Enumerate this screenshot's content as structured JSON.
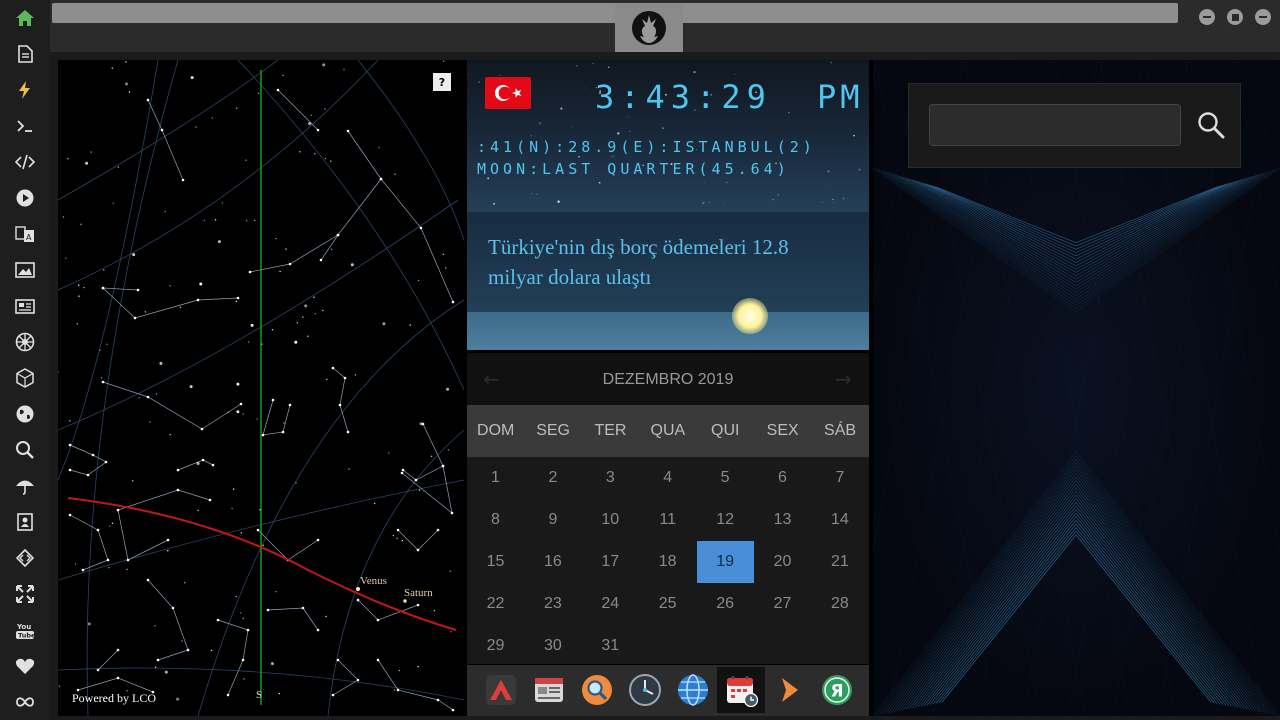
{
  "sidebar": {
    "items": [
      {
        "name": "home-icon",
        "color": "#5cb85c"
      },
      {
        "name": "document-icon",
        "color": "#e0e0e0"
      },
      {
        "name": "lightning-icon",
        "color": "#f0c040"
      },
      {
        "name": "terminal-icon",
        "color": "#e0e0e0"
      },
      {
        "name": "code-icon",
        "color": "#e0e0e0"
      },
      {
        "name": "play-icon",
        "color": "#e0e0e0"
      },
      {
        "name": "translate-icon",
        "color": "#e0e0e0"
      },
      {
        "name": "image-icon",
        "color": "#e0e0e0"
      },
      {
        "name": "newspaper-icon",
        "color": "#e0e0e0"
      },
      {
        "name": "empire-icon",
        "color": "#e0e0e0"
      },
      {
        "name": "cube-icon",
        "color": "#e0e0e0"
      },
      {
        "name": "globe-icon",
        "color": "#e0e0e0"
      },
      {
        "name": "search-icon",
        "color": "#e0e0e0"
      },
      {
        "name": "umbrella-icon",
        "color": "#e0e0e0"
      },
      {
        "name": "contact-book-icon",
        "color": "#e0e0e0"
      },
      {
        "name": "code-tag-icon",
        "color": "#e0e0e0"
      },
      {
        "name": "expand-icon",
        "color": "#e0e0e0"
      },
      {
        "name": "youtube-icon",
        "color": "#e0e0e0",
        "label": "You Tube"
      },
      {
        "name": "heart-icon",
        "color": "#e0e0e0"
      },
      {
        "name": "infinity-icon",
        "color": "#e0e0e0"
      }
    ]
  },
  "window": {
    "logo_icon": "rebel-alliance-icon"
  },
  "sky": {
    "help": "?",
    "powered": "Powered by LCO",
    "compass": "S",
    "planets": [
      {
        "name": "Venus"
      },
      {
        "name": "Saturn"
      }
    ]
  },
  "clock": {
    "time": "3:43:29",
    "ampm": "PM",
    "location": ":41(N):28.9(E):ISTANBUL(2)",
    "moon": "MOON:LAST QUARTER(45.64)",
    "flag": "turkey-flag",
    "news": "Türkiye'nin dış borç ödemeleri 12.8 milyar dolara ulaştı"
  },
  "calendar": {
    "month": "DEZEMBRO 2019",
    "prev": "←",
    "next": "→",
    "weekdays": [
      "DOM",
      "SEG",
      "TER",
      "QUA",
      "QUI",
      "SEX",
      "SÁB"
    ],
    "days": [
      "1",
      "2",
      "3",
      "4",
      "5",
      "6",
      "7",
      "8",
      "9",
      "10",
      "11",
      "12",
      "13",
      "14",
      "15",
      "16",
      "17",
      "18",
      "19",
      "20",
      "21",
      "22",
      "23",
      "24",
      "25",
      "26",
      "27",
      "28",
      "29",
      "30",
      "31"
    ],
    "first_weekday": 0,
    "today": "19",
    "today_color": "#4a8ed8"
  },
  "dock": {
    "items": [
      {
        "name": "app-launcher-icon"
      },
      {
        "name": "news-reader-icon"
      },
      {
        "name": "search-app-icon"
      },
      {
        "name": "clock-app-icon"
      },
      {
        "name": "browser-globe-icon"
      },
      {
        "name": "calendar-app-icon",
        "active": true
      },
      {
        "name": "chevron-right-app-icon"
      },
      {
        "name": "yandex-icon",
        "label": "Я"
      }
    ]
  },
  "search": {
    "placeholder": "",
    "value": ""
  }
}
